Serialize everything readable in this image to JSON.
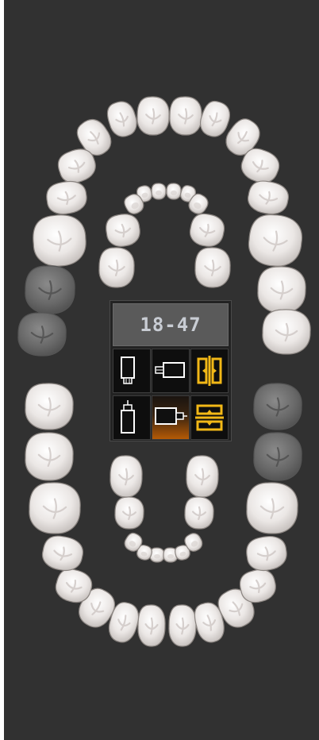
{
  "tooth_range": "18-47",
  "colors": {
    "background": "#313131",
    "tooth_enamel": "#f2efed",
    "tooth_shade": "#cfc9c6",
    "tooth_missing": "#6d6d6d",
    "tooth_outline": "#8a8480",
    "icon_accent": "#f2b817",
    "active_glow": "#b55a06"
  },
  "controls": [
    {
      "id": "view-upper-front",
      "icon": "upper-arch-front-icon",
      "active": false
    },
    {
      "id": "view-upper-side",
      "icon": "upper-arch-side-icon",
      "active": false
    },
    {
      "id": "split-vertical",
      "icon": "split-vertical-icon",
      "active": false
    },
    {
      "id": "view-lower-front",
      "icon": "lower-arch-front-icon",
      "active": false
    },
    {
      "id": "view-lower-side",
      "icon": "lower-arch-side-icon",
      "active": true
    },
    {
      "id": "split-horizontal",
      "icon": "split-horizontal-icon",
      "active": false
    }
  ],
  "upper_arch": {
    "permanent": [
      "11",
      "12",
      "13",
      "14",
      "15",
      "16",
      "17",
      "18",
      "21",
      "22",
      "23",
      "24",
      "25",
      "26",
      "27",
      "28"
    ],
    "primary": [
      "51",
      "52",
      "53",
      "54",
      "55",
      "61",
      "62",
      "63",
      "64",
      "65"
    ]
  },
  "lower_arch": {
    "permanent": [
      "31",
      "32",
      "33",
      "34",
      "35",
      "36",
      "37",
      "38",
      "41",
      "42",
      "43",
      "44",
      "45",
      "46",
      "47",
      "48"
    ],
    "primary": [
      "71",
      "72",
      "73",
      "74",
      "75",
      "81",
      "82",
      "83",
      "84",
      "85"
    ]
  },
  "missing_teeth": [
    "17",
    "18",
    "47",
    "48"
  ]
}
